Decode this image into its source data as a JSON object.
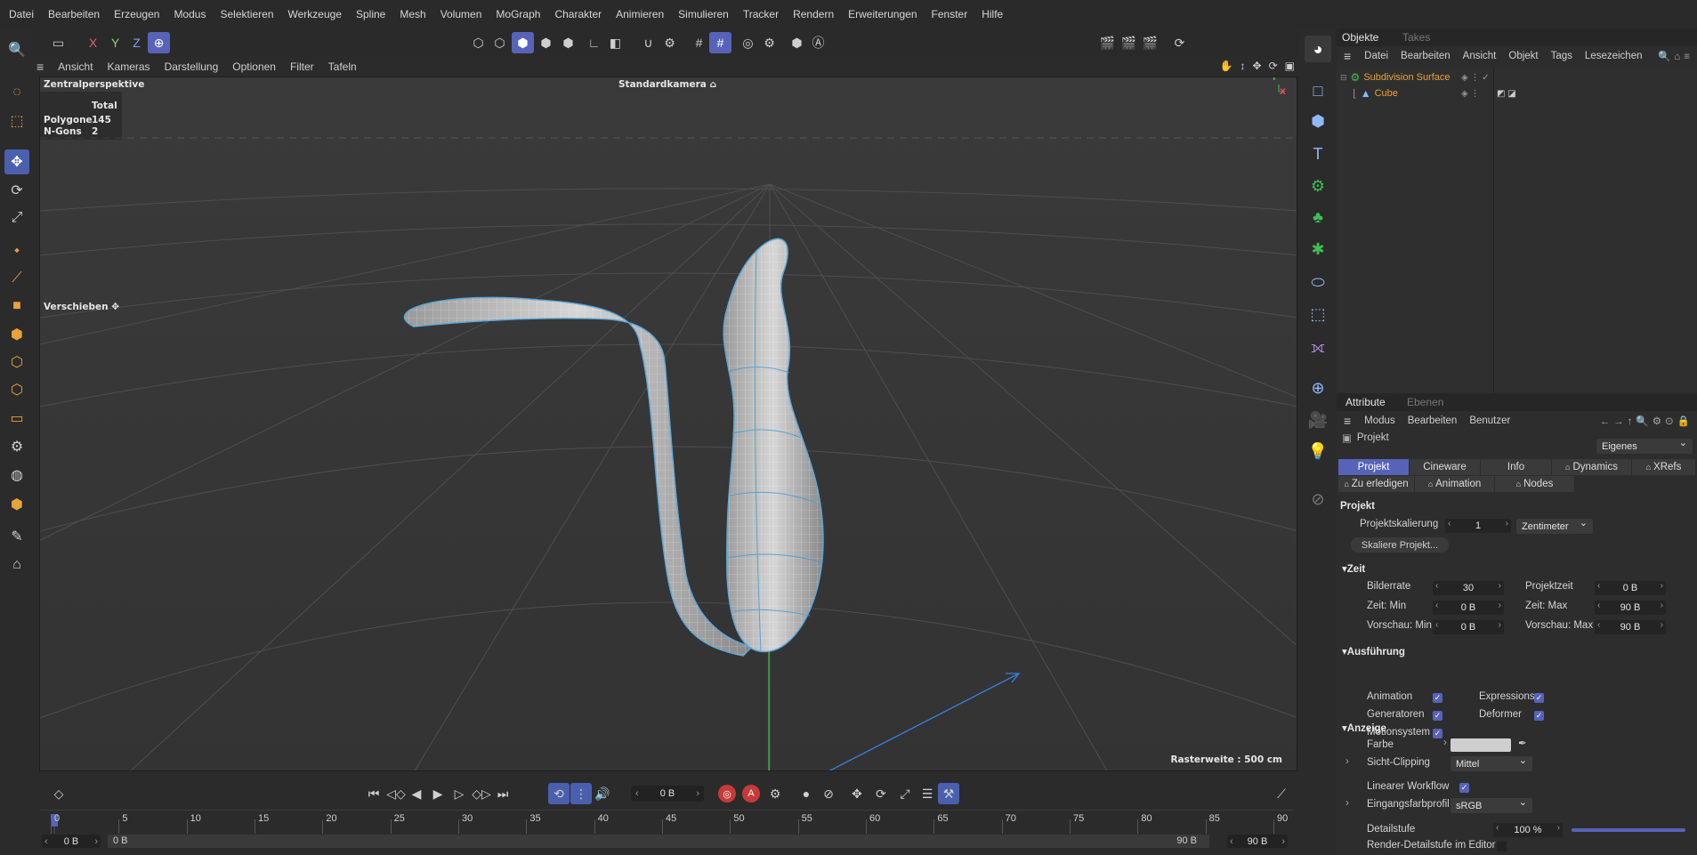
{
  "menu": [
    "Datei",
    "Bearbeiten",
    "Erzeugen",
    "Modus",
    "Selektieren",
    "Werkzeuge",
    "Spline",
    "Mesh",
    "Volumen",
    "MoGraph",
    "Charakter",
    "Animieren",
    "Simulieren",
    "Tracker",
    "Rendern",
    "Erweiterungen",
    "Fenster",
    "Hilfe"
  ],
  "axis_buttons": {
    "x": "X",
    "y": "Y",
    "z": "Z"
  },
  "viewport_menu": [
    "Ansicht",
    "Kameras",
    "Darstellung",
    "Optionen",
    "Filter",
    "Tafeln"
  ],
  "viewport": {
    "projection": "Zentralperspektive",
    "camera": "Standardkamera",
    "stats_header": "Total",
    "stats": [
      {
        "label": "Polygone",
        "value": "145"
      },
      {
        "label": "N-Gons",
        "value": "2"
      }
    ],
    "tool_label": "Verschieben",
    "grid_info": "Rasterweite : 500 cm",
    "axis_y": "Y",
    "axis_x": "X"
  },
  "timeline": {
    "frame_field": "0 B",
    "ruler": [
      "0",
      "5",
      "10",
      "15",
      "20",
      "25",
      "30",
      "35",
      "40",
      "45",
      "50",
      "55",
      "60",
      "65",
      "70",
      "75",
      "80",
      "85",
      "90"
    ],
    "start_field": "0 B",
    "range_start": "0 B",
    "range_end": "90 B",
    "end_field": "90 B",
    "key_a": "A"
  },
  "objects_panel": {
    "tabs": [
      "Objekte",
      "Takes"
    ],
    "menu": [
      "Datei",
      "Bearbeiten",
      "Ansicht",
      "Objekt",
      "Tags",
      "Lesezeichen"
    ],
    "items": [
      {
        "name": "Subdivision Surface",
        "color": "#e8a23a"
      },
      {
        "name": "Cube",
        "color": "#e8a23a"
      }
    ]
  },
  "attributes_panel": {
    "tabs": [
      "Attribute",
      "Ebenen"
    ],
    "menu": [
      "Modus",
      "Bearbeiten",
      "Benutzer"
    ],
    "context": "Projekt",
    "context_dropdown": "Eigenes",
    "subtabs_row1": [
      "Projekt",
      "Cineware",
      "Info",
      "Dynamics",
      "XRefs"
    ],
    "subtabs_row2": [
      "Zu erledigen",
      "Animation",
      "Nodes"
    ],
    "section_title": "Projekt",
    "projektskalierung_label": "Projektskalierung",
    "projektskalierung_value": "1",
    "projektskalierung_unit": "Zentimeter",
    "skaliere_button": "Skaliere Projekt...",
    "zeit": {
      "title": "Zeit",
      "rows": [
        {
          "l1": "Bilderrate",
          "v1": "30",
          "l2": "Projektzeit",
          "v2": "0 B"
        },
        {
          "l1": "Zeit: Min",
          "v1": "0 B",
          "l2": "Zeit: Max",
          "v2": "90 B"
        },
        {
          "l1": "Vorschau: Min",
          "v1": "0 B",
          "l2": "Vorschau: Max",
          "v2": "90 B"
        }
      ]
    },
    "ausfuehrung": {
      "title": "Ausführung",
      "left": [
        "Animation",
        "Generatoren",
        "Motionsystem"
      ],
      "right": [
        "Expressions",
        "Deformer"
      ]
    },
    "anzeige": {
      "title": "Anzeige",
      "farbe_label": "Farbe",
      "farbe_color": "#cfcfcf",
      "sicht_label": "Sicht-Clipping",
      "sicht_value": "Mittel",
      "linear_label": "Linearer Workflow",
      "eingang_label": "Eingangsfarbprofil",
      "eingang_value": "sRGB",
      "detail_label": "Detailstufe",
      "detail_value": "100 %",
      "render_detail_label": "Render-Detailstufe im Editor"
    }
  },
  "colors": {
    "accent": "#5663b8",
    "orange": "#e8a23a",
    "panel": "#2d2d2d"
  }
}
